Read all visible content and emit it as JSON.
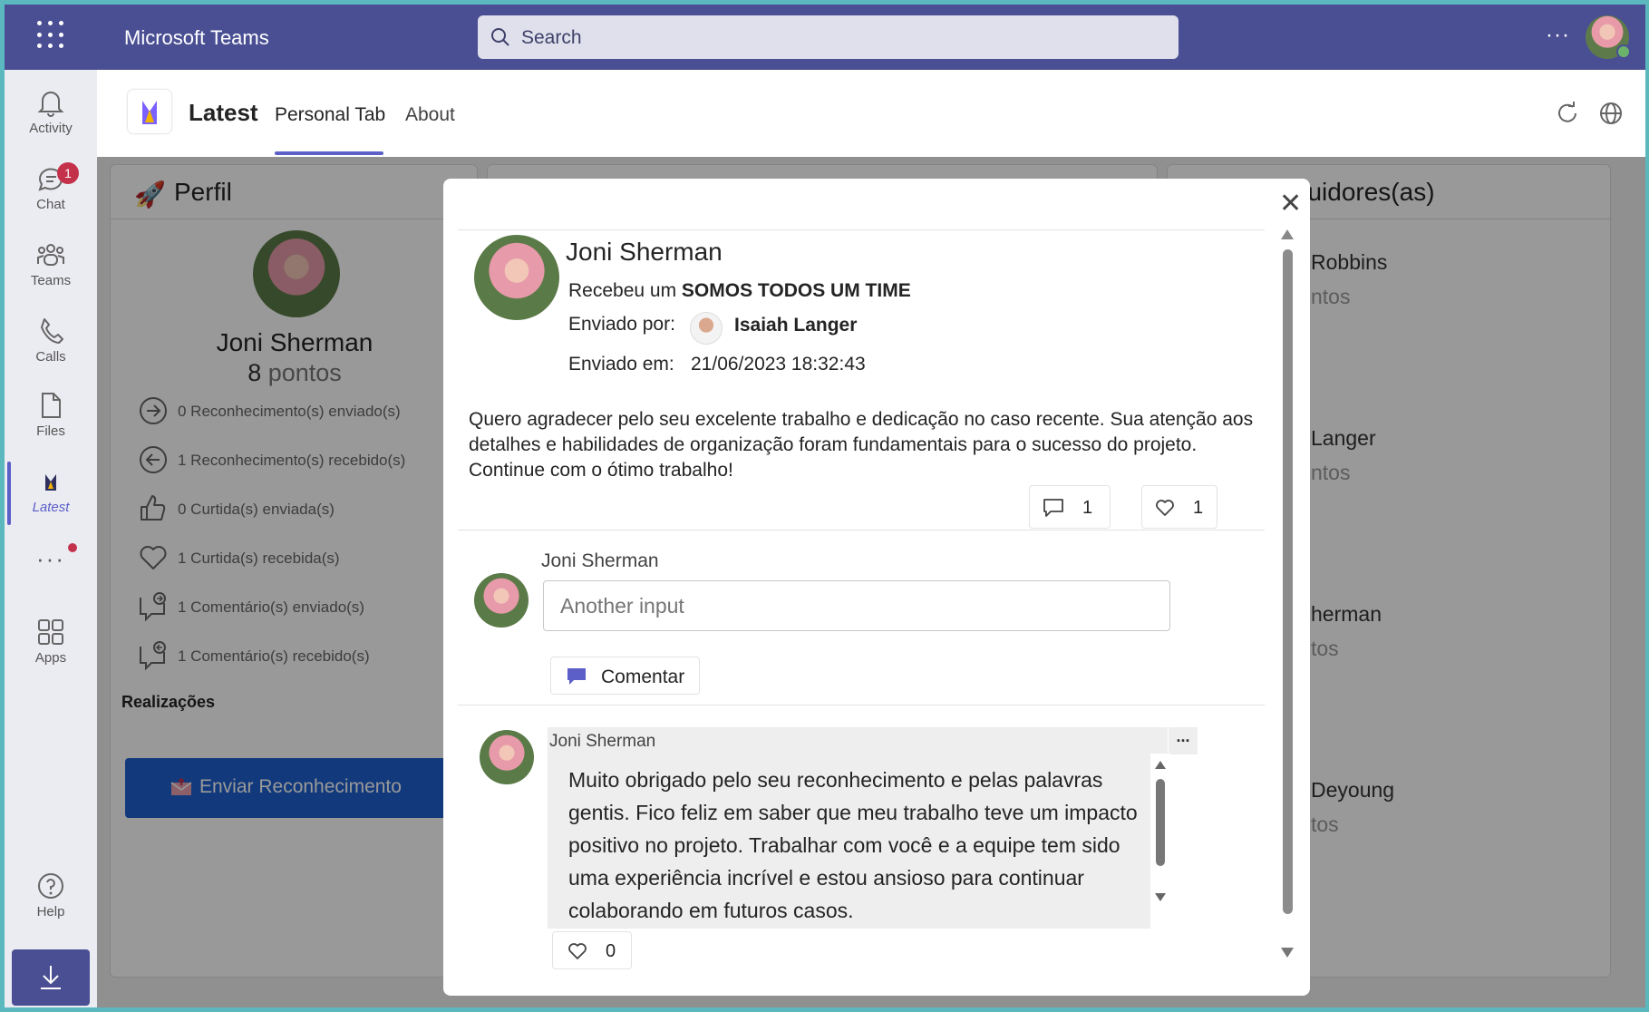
{
  "app": {
    "title": "Microsoft Teams"
  },
  "search": {
    "placeholder": "Search"
  },
  "rail": {
    "items": [
      {
        "label": "Activity",
        "icon": "bell-icon"
      },
      {
        "label": "Chat",
        "icon": "chat-icon",
        "badge": "1"
      },
      {
        "label": "Teams",
        "icon": "teams-icon"
      },
      {
        "label": "Calls",
        "icon": "phone-icon"
      },
      {
        "label": "Files",
        "icon": "file-icon"
      },
      {
        "label": "Latest",
        "icon": "latest-app-icon"
      },
      {
        "label": "Apps",
        "icon": "apps-icon"
      },
      {
        "label": "Help",
        "icon": "help-icon"
      }
    ]
  },
  "tabhead": {
    "app_name": "Latest",
    "tabs": [
      "Personal Tab",
      "About"
    ]
  },
  "profile": {
    "header": "Perfil",
    "name": "Joni Sherman",
    "points_value": "8",
    "points_label": "pontos",
    "stats": [
      "0 Reconhecimento(s) enviado(s)",
      "1 Reconhecimento(s) recebido(s)",
      "0 Curtida(s) enviada(s)",
      "1 Curtida(s) recebida(s)",
      "1 Comentário(s) enviado(s)",
      "1 Comentário(s) recebido(s)"
    ],
    "achievements_title": "Realizações",
    "send_button": "Enviar Reconhecimento"
  },
  "contributors": {
    "header": "ntribuidores(as)",
    "items": [
      {
        "name": "Robbins",
        "points": "ntos"
      },
      {
        "name": "Langer",
        "points": "ntos"
      },
      {
        "name": "herman",
        "points": "tos"
      },
      {
        "name": "Deyoung",
        "points": "tos"
      }
    ]
  },
  "modal": {
    "recipient_name": "Joni Sherman",
    "received_prefix": "Recebeu um",
    "award_title": "SOMOS TODOS UM TIME",
    "sent_by_label": "Enviado por:",
    "sender_name": "Isaiah Langer",
    "sent_at_label": "Enviado em:",
    "sent_at": "21/06/2023 18:32:43",
    "message": "Quero agradecer pelo seu excelente trabalho e dedicação no caso recente. Sua atenção aos detalhes e habilidades de organização foram fundamentais para o sucesso do projeto. Continue com o ótimo trabalho!",
    "comment_count": "1",
    "like_count": "1",
    "compose_author": "Joni Sherman",
    "compose_placeholder": "Another input",
    "comment_button": "Comentar",
    "reply": {
      "author": "Joni Sherman",
      "text": "Muito obrigado pelo seu reconhecimento e pelas palavras gentis. Fico feliz em saber que meu trabalho teve um impacto positivo no projeto. Trabalhar com você e a equipe tem sido uma experiência incrível e estou ansioso para continuar colaborando em futuros casos.",
      "more_label": "...",
      "like_count": "0"
    }
  },
  "colors": {
    "brand": "#4a4f94",
    "accent": "#5b5fc7",
    "primary_button": "#1d5fcf",
    "badge": "#c4314b"
  }
}
